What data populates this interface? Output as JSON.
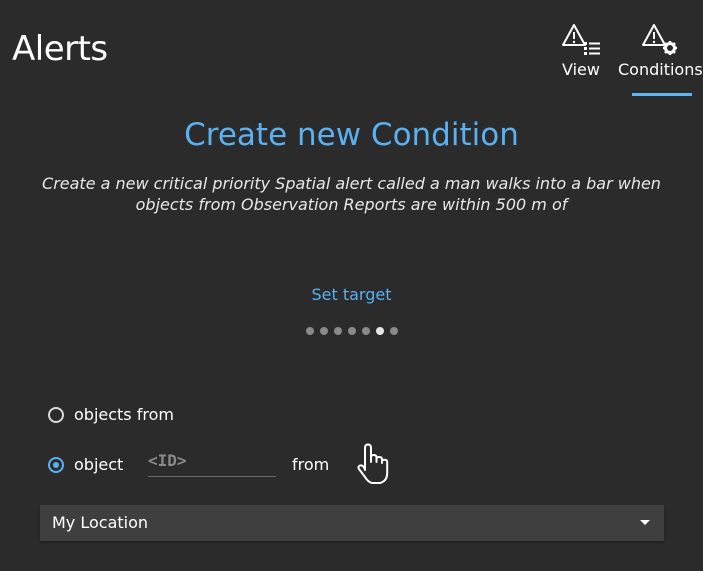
{
  "header": {
    "title": "Alerts",
    "buttons": [
      {
        "label": "View",
        "icon": "warning-list-icon"
      },
      {
        "label": "Conditions",
        "icon": "warning-gear-icon"
      }
    ],
    "active_tab": "Conditions"
  },
  "main": {
    "heading": "Create new Condition",
    "description": "Create a new critical priority Spatial alert called a man walks into a bar when objects from Observation Reports are within 500 m of",
    "step_label": "Set target",
    "steps": {
      "total": 7,
      "current": 6
    },
    "options": {
      "objects_from_label": "objects from",
      "object_label": "object",
      "id_placeholder": "<ID>",
      "from_label": "from",
      "pick_icon": "hand-pointer-icon"
    },
    "selected_option": "object",
    "location_select": {
      "value": "My Location"
    }
  },
  "colors": {
    "background": "#2b2b2b",
    "accent": "#5ab0f0",
    "select_background": "#3f3f3f"
  }
}
